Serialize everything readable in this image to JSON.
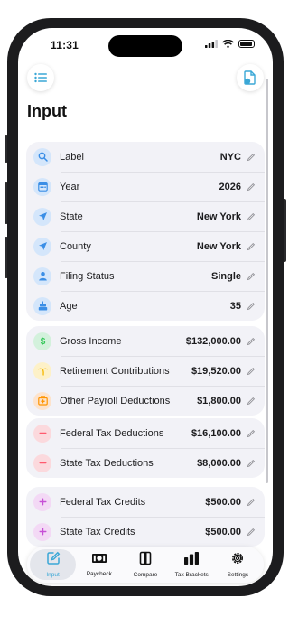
{
  "status": {
    "time": "11:31"
  },
  "page": {
    "title": "Input"
  },
  "sections": [
    {
      "rows": [
        {
          "name": "label",
          "label": "Label",
          "value": "NYC",
          "icon": "magnifier-icon",
          "bg": "#d4e6fb",
          "fg": "#3a8ee6"
        },
        {
          "name": "year",
          "label": "Year",
          "value": "2026",
          "icon": "calendar-icon",
          "bg": "#d4e6fb",
          "fg": "#3a8ee6"
        },
        {
          "name": "state",
          "label": "State",
          "value": "New York",
          "icon": "location-arrow-icon",
          "bg": "#d4e6fb",
          "fg": "#3a8ee6"
        },
        {
          "name": "county",
          "label": "County",
          "value": "New York",
          "icon": "location-arrow-icon",
          "bg": "#d4e6fb",
          "fg": "#3a8ee6"
        },
        {
          "name": "filing-status",
          "label": "Filing Status",
          "value": "Single",
          "icon": "person-icon",
          "bg": "#d4e6fb",
          "fg": "#3a8ee6"
        },
        {
          "name": "age",
          "label": "Age",
          "value": "35",
          "icon": "cake-icon",
          "bg": "#d4e6fb",
          "fg": "#3a8ee6"
        }
      ]
    },
    {
      "rows": [
        {
          "name": "gross-income",
          "label": "Gross Income",
          "value": "$132,000.00",
          "icon": "dollar-icon",
          "bg": "#d3f1dc",
          "fg": "#34c759"
        },
        {
          "name": "retirement-contributions",
          "label": "Retirement Contributions",
          "value": "$19,520.00",
          "icon": "palm-tree-icon",
          "bg": "#fdf1c8",
          "fg": "#f5b800"
        },
        {
          "name": "other-payroll-deductions",
          "label": "Other Payroll Deductions",
          "value": "$1,800.00",
          "icon": "first-aid-icon",
          "bg": "#fde3cc",
          "fg": "#ff9500"
        }
      ]
    },
    {
      "rows": [
        {
          "name": "federal-tax-deductions",
          "label": "Federal Tax Deductions",
          "value": "$16,100.00",
          "icon": "minus-icon",
          "bg": "#fbd9dd",
          "fg": "#ff5a6e"
        },
        {
          "name": "state-tax-deductions",
          "label": "State Tax Deductions",
          "value": "$8,000.00",
          "icon": "minus-icon",
          "bg": "#fbd9dd",
          "fg": "#ff5a6e"
        }
      ]
    },
    {
      "rows": [
        {
          "name": "federal-tax-credits",
          "label": "Federal Tax Credits",
          "value": "$500.00",
          "icon": "plus-icon",
          "bg": "#f3d9f5",
          "fg": "#c64fd6"
        },
        {
          "name": "state-tax-credits",
          "label": "State Tax Credits",
          "value": "$500.00",
          "icon": "plus-icon",
          "bg": "#f3d9f5",
          "fg": "#c64fd6"
        }
      ]
    }
  ],
  "tabs": [
    {
      "name": "input",
      "label": "Input",
      "icon": "pencil-square-icon",
      "active": true
    },
    {
      "name": "paycheck",
      "label": "Paycheck",
      "icon": "banknote-icon",
      "active": false
    },
    {
      "name": "compare",
      "label": "Compare",
      "icon": "split-rect-icon",
      "active": false
    },
    {
      "name": "tax-brackets",
      "label": "Tax Brackets",
      "icon": "bar-chart-icon",
      "active": false
    },
    {
      "name": "settings",
      "label": "Settings",
      "icon": "gear-icon",
      "active": false
    }
  ],
  "colors": {
    "accent": "#3aa7d6",
    "card_bg": "#f2f2f7"
  }
}
